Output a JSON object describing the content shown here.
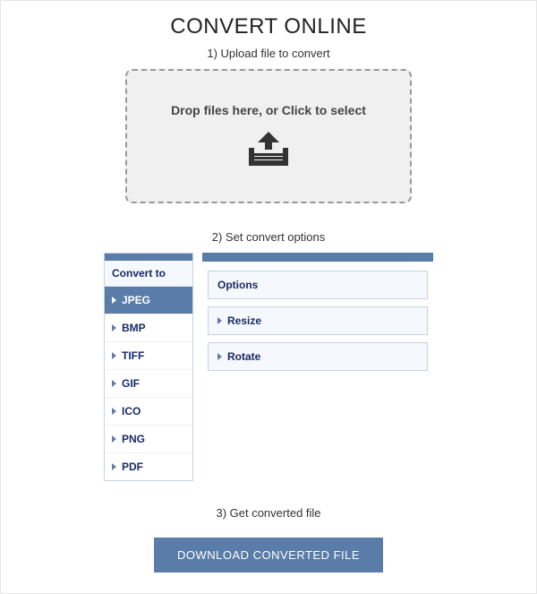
{
  "title": "CONVERT ONLINE",
  "step1": {
    "label": "1) Upload file to convert",
    "dropzone_text": "Drop files here, or Click to select"
  },
  "step2": {
    "label": "2) Set convert options",
    "convert_to_header": "Convert to",
    "formats": [
      "JPEG",
      "BMP",
      "TIFF",
      "GIF",
      "ICO",
      "PNG",
      "PDF"
    ],
    "selected_format": "JPEG",
    "options_header": "Options",
    "option_blocks": [
      "Resize",
      "Rotate"
    ]
  },
  "step3": {
    "label": "3) Get converted file",
    "button": "DOWNLOAD CONVERTED FILE"
  }
}
